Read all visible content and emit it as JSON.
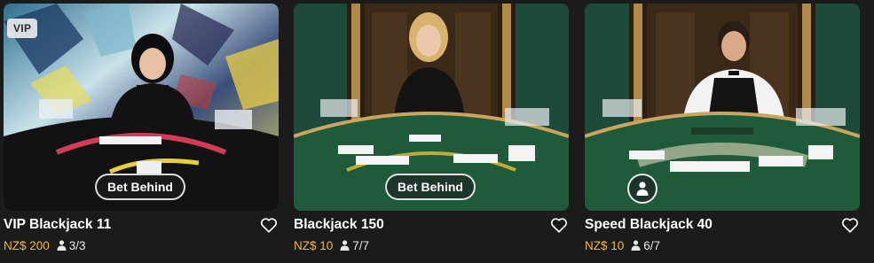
{
  "games": [
    {
      "badge": "VIP",
      "action": "Bet Behind",
      "title": "VIP Blackjack 11",
      "stake": "NZ$ 200",
      "seats": "3/3",
      "favorite_icon": "heart-outline",
      "seat_icon": "person-icon"
    },
    {
      "badge": "",
      "action": "Bet Behind",
      "title": "Blackjack 150",
      "stake": "NZ$ 10",
      "seats": "7/7",
      "favorite_icon": "heart-outline",
      "seat_icon": "person-icon"
    },
    {
      "badge": "",
      "action_icon": "avatar-icon",
      "title": "Speed Blackjack 40",
      "stake": "NZ$ 10",
      "seats": "6/7",
      "favorite_icon": "heart-outline",
      "seat_icon": "person-icon"
    }
  ],
  "colors": {
    "background": "#1b1b1b",
    "stake": "#f5b73c",
    "table_green": "#1f5a3a",
    "vip_table": "#121212"
  }
}
